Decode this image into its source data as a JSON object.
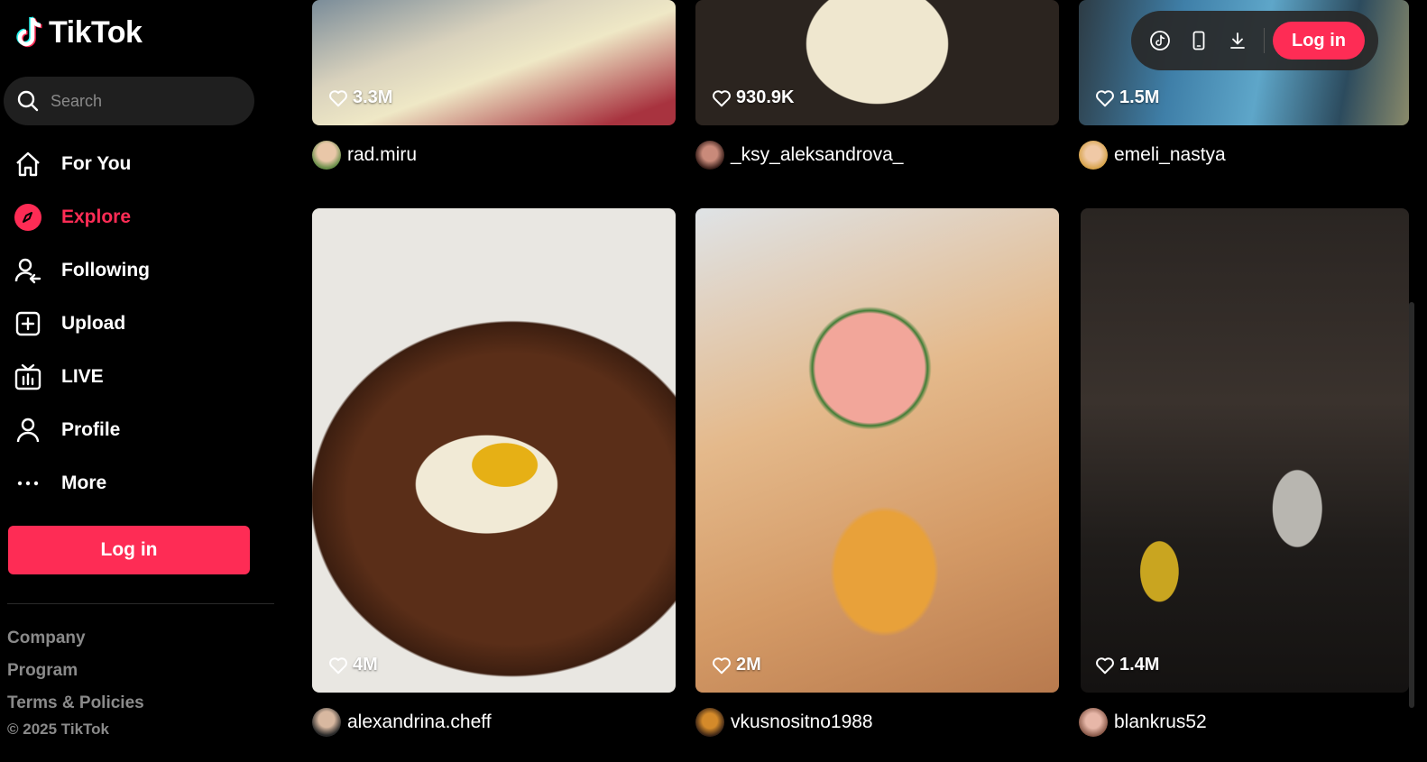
{
  "app": {
    "name": "TikTok"
  },
  "search": {
    "placeholder": "Search"
  },
  "nav": {
    "items": [
      {
        "label": "For You",
        "icon": "home-icon"
      },
      {
        "label": "Explore",
        "icon": "compass-icon",
        "active": true
      },
      {
        "label": "Following",
        "icon": "following-icon"
      },
      {
        "label": "Upload",
        "icon": "upload-icon"
      },
      {
        "label": "LIVE",
        "icon": "live-icon"
      },
      {
        "label": "Profile",
        "icon": "profile-icon"
      },
      {
        "label": "More",
        "icon": "more-icon"
      }
    ]
  },
  "sidebar": {
    "login_label": "Log in"
  },
  "footer": {
    "links": [
      "Company",
      "Program",
      "Terms & Policies"
    ],
    "copyright": "© 2025 TikTok"
  },
  "topbar": {
    "login_label": "Log in",
    "icons": [
      "tiktok-app-icon",
      "mobile-icon",
      "download-icon"
    ]
  },
  "videos": [
    {
      "likes": "3.3M",
      "author": "rad.miru"
    },
    {
      "likes": "930.9K",
      "author": "_ksy_aleksandrova_"
    },
    {
      "likes": "1.5M",
      "author": "emeli_nastya"
    },
    {
      "likes": "4M",
      "author": "alexandrina.cheff"
    },
    {
      "likes": "2M",
      "author": "vkusnositno1988"
    },
    {
      "likes": "1.4M",
      "author": "blankrus52"
    }
  ],
  "colors": {
    "accent": "#fe2c55",
    "background": "#000000",
    "muted": "#8a8a8a"
  }
}
